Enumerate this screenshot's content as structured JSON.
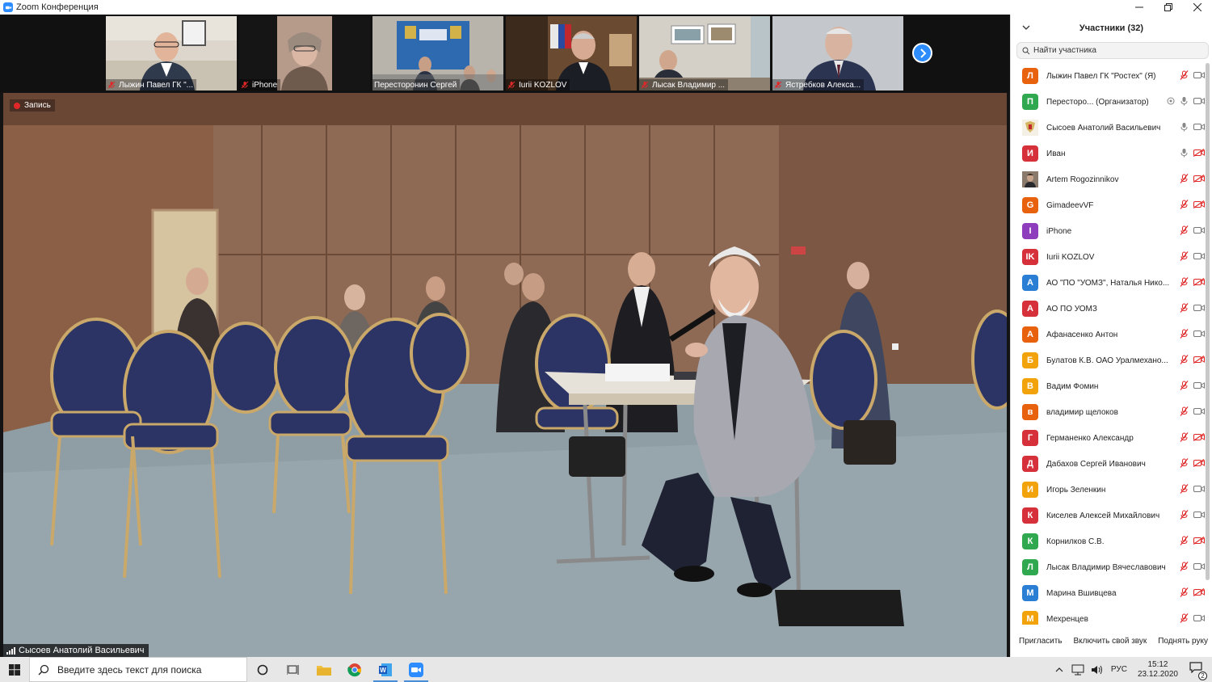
{
  "window": {
    "title": "Zoom Конференция",
    "controls": [
      "minimize",
      "restore",
      "close"
    ]
  },
  "thumbnails": [
    {
      "name": "Лыжин Павел ГК \"...",
      "muted": true
    },
    {
      "name": "iPhone",
      "muted": true
    },
    {
      "name": "Пересторонин Сергей",
      "muted": false
    },
    {
      "name": "Iurii KOZLOV",
      "muted": true
    },
    {
      "name": "Лысак Владимир ...",
      "muted": true
    },
    {
      "name": "Ястребков Алекса...",
      "muted": true
    }
  ],
  "speaker": {
    "recording_label": "Запись",
    "name": "Сысоев Анатолий Васильевич"
  },
  "participants_panel": {
    "title": "Участники (32)",
    "search_placeholder": "Найти участника",
    "participants": [
      {
        "initial": "Л",
        "color": "#e8620d",
        "name": "Лыжин Павел ГК \"Ростех\" (Я)",
        "mic": "muted",
        "video": "on"
      },
      {
        "initial": "П",
        "color": "#2fa84f",
        "name": "Пересторо...  (Организатор)",
        "mic": "on",
        "video": "on",
        "host": true
      },
      {
        "initial": "",
        "color": "#f4f0e6",
        "name": "Сысоев Анатолий Васильевич",
        "mic": "on",
        "video": "on",
        "photo": true
      },
      {
        "initial": "И",
        "color": "#d6303a",
        "name": "Иван",
        "mic": "on",
        "video": "off"
      },
      {
        "initial": "",
        "color": "#5b4a3c",
        "name": "Artem Rogozinnikov",
        "mic": "muted",
        "video": "off",
        "photo": true
      },
      {
        "initial": "G",
        "color": "#e8620d",
        "name": "GimadeevVF",
        "mic": "muted",
        "video": "off"
      },
      {
        "initial": "I",
        "color": "#8e3ebc",
        "name": "iPhone",
        "mic": "muted",
        "video": "on"
      },
      {
        "initial": "IK",
        "color": "#d6303a",
        "name": "Iurii KOZLOV",
        "mic": "muted",
        "video": "on"
      },
      {
        "initial": "А",
        "color": "#2a7fd4",
        "name": "АО \"ПО \"УОМЗ\", Наталья Нико...",
        "mic": "muted",
        "video": "off"
      },
      {
        "initial": "А",
        "color": "#d6303a",
        "name": "АО ПО УОМЗ",
        "mic": "muted",
        "video": "on"
      },
      {
        "initial": "А",
        "color": "#e8620d",
        "name": "Афанасенко Антон",
        "mic": "muted",
        "video": "on"
      },
      {
        "initial": "Б",
        "color": "#f2a20b",
        "name": "Булатов К.В. ОАО Уралмехано...",
        "mic": "muted",
        "video": "off"
      },
      {
        "initial": "В",
        "color": "#f2a20b",
        "name": "Вадим Фомин",
        "mic": "muted",
        "video": "on"
      },
      {
        "initial": "в",
        "color": "#e8620d",
        "name": "владимир щелоков",
        "mic": "muted",
        "video": "on"
      },
      {
        "initial": "Г",
        "color": "#d6303a",
        "name": "Германенко Александр",
        "mic": "muted",
        "video": "off"
      },
      {
        "initial": "Д",
        "color": "#d6303a",
        "name": "Дабахов Сергей Иванович",
        "mic": "muted",
        "video": "off"
      },
      {
        "initial": "И",
        "color": "#f2a20b",
        "name": "Игорь Зеленкин",
        "mic": "muted",
        "video": "on"
      },
      {
        "initial": "К",
        "color": "#d6303a",
        "name": "Киселев Алексей Михайлович",
        "mic": "muted",
        "video": "on"
      },
      {
        "initial": "К",
        "color": "#2fa84f",
        "name": "Корнилков С.В.",
        "mic": "muted",
        "video": "off"
      },
      {
        "initial": "Л",
        "color": "#2fa84f",
        "name": "Лысак Владимир Вячеславович",
        "mic": "muted",
        "video": "on"
      },
      {
        "initial": "М",
        "color": "#2a7fd4",
        "name": "Марина Вшивцева",
        "mic": "muted",
        "video": "off"
      },
      {
        "initial": "М",
        "color": "#f2a20b",
        "name": "Мехренцев",
        "mic": "muted",
        "video": "on"
      }
    ],
    "footer": {
      "invite": "Пригласить",
      "unmute": "Включить свой звук",
      "raise_hand": "Поднять руку"
    }
  },
  "taskbar": {
    "search_placeholder": "Введите здесь текст для поиска",
    "language": "РУС",
    "time": "15:12",
    "date": "23.12.2020",
    "notification_count": "2"
  },
  "colors": {
    "zoom_blue": "#2d8cff",
    "muted_red": "#e02828"
  }
}
